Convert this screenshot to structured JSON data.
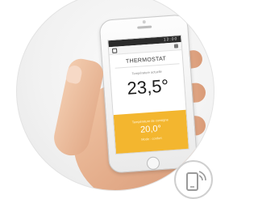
{
  "app": {
    "title": "THERMOSTAT",
    "current_label": "Température actuelle",
    "current_temperature": "23,5°",
    "setpoint_label": "Température de consigne",
    "setpoint_temperature": "20,0°",
    "setpoint_subtext": "Mode : confort",
    "status_text": "12:00"
  },
  "colors": {
    "accent": "#f3b62f",
    "badge_icon": "#9a9a9a"
  },
  "icons": {
    "badge": "smartphone-wifi-icon"
  }
}
